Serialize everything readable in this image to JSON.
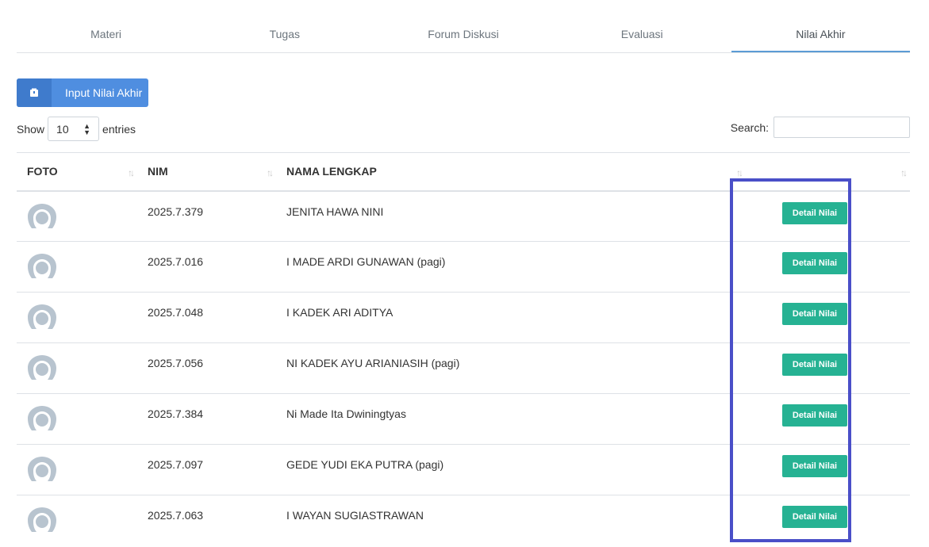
{
  "tabs": [
    {
      "label": "Materi"
    },
    {
      "label": "Tugas"
    },
    {
      "label": "Forum Diskusi"
    },
    {
      "label": "Evaluasi"
    },
    {
      "label": "Nilai Akhir"
    }
  ],
  "active_tab": "Nilai Akhir",
  "toolbar": {
    "input_label": "Input Nilai Akhir",
    "input_icon": "box-icon"
  },
  "length": {
    "show_label": "Show",
    "value": "10",
    "entries_label": "entries"
  },
  "search": {
    "label": "Search:",
    "value": ""
  },
  "table": {
    "columns": [
      "FOTO",
      "NIM",
      "NAMA LENGKAP",
      ""
    ],
    "button_label": "Detail Nilai",
    "rows": [
      {
        "nim": "2025.7.379",
        "nama": "JENITA HAWA NINI"
      },
      {
        "nim": "2025.7.016",
        "nama": "I MADE ARDI GUNAWAN (pagi)"
      },
      {
        "nim": "2025.7.048",
        "nama": "I KADEK ARI ADITYA"
      },
      {
        "nim": "2025.7.056",
        "nama": "NI KADEK AYU ARIANIASIH (pagi)"
      },
      {
        "nim": "2025.7.384",
        "nama": "Ni Made Ita Dwiningtyas"
      },
      {
        "nim": "2025.7.097",
        "nama": "GEDE YUDI EKA PUTRA (pagi)"
      },
      {
        "nim": "2025.7.063",
        "nama": "I WAYAN SUGIASTRAWAN"
      }
    ]
  },
  "colors": {
    "primary_button": "#4f8ee0",
    "detail_button": "#26b293",
    "highlight_box": "#4a4fc8",
    "active_tab_border": "#5b9bd5"
  }
}
